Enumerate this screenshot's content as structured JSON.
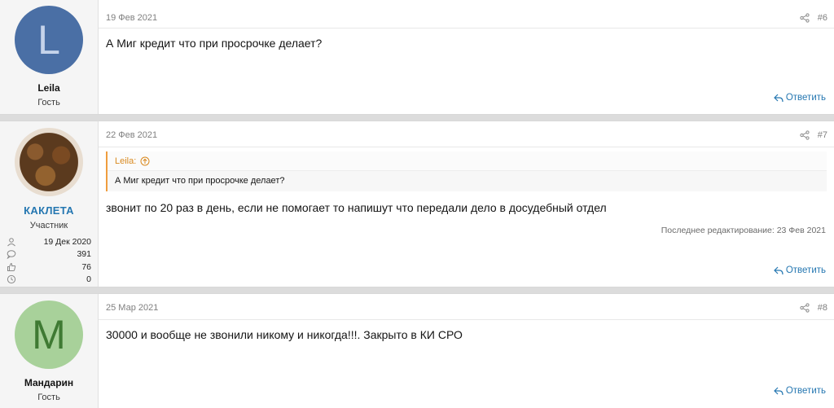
{
  "posts": [
    {
      "user": {
        "initial": "L",
        "name": "Leila",
        "title": "Гость"
      },
      "date": "19 Фев 2021",
      "num": "#6",
      "text": "А Миг кредит что при просрочке делает?",
      "reply": "Ответить"
    },
    {
      "user": {
        "name": "КАКЛЕТА",
        "title": "Участник",
        "stats": [
          {
            "icon": "user-icon",
            "value": "19 Дек 2020"
          },
          {
            "icon": "message-icon",
            "value": "391"
          },
          {
            "icon": "thumbs-up-icon",
            "value": "76"
          },
          {
            "icon": "trophy-icon",
            "value": "0"
          }
        ]
      },
      "date": "22 Фев 2021",
      "num": "#7",
      "quote": {
        "author": "Leila:",
        "text": "А Миг кредит что при просрочке делает?"
      },
      "text": "звонит по 20 раз в день, если не помогает то напишут что передали дело в досудебный отдел",
      "edited": "Последнее редактирование: 23 Фев 2021",
      "reply": "Ответить"
    },
    {
      "user": {
        "initial": "M",
        "name": "Мандарин",
        "title": "Гость"
      },
      "date": "25 Мар 2021",
      "num": "#8",
      "text": "30000 и вообще не звонили никому и никогда!!!. Закрыто в КИ СРО",
      "reply": "Ответить"
    }
  ],
  "colors": {
    "link": "#2577b1",
    "quote_accent": "#f09d3e"
  }
}
